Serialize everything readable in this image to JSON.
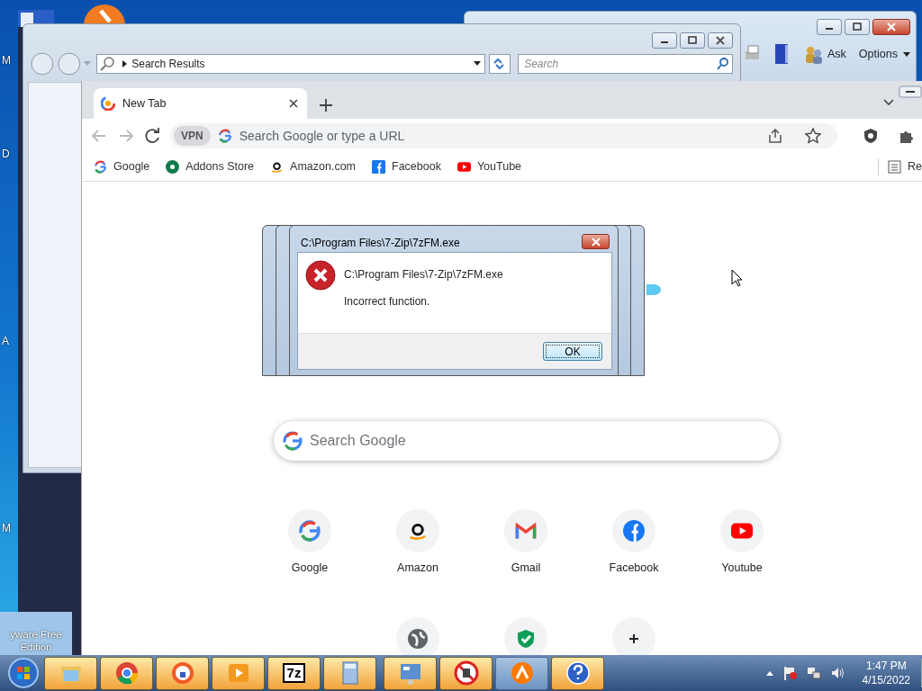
{
  "desktop": {
    "icon_labels": [
      "M",
      "D",
      "A",
      "M"
    ],
    "bottom_icon_label": [
      "yware Free",
      "Edition"
    ]
  },
  "help_window": {
    "toolbar": [
      {
        "kind": "print"
      },
      {
        "kind": "book"
      },
      {
        "kind": "ask",
        "label": "Ask"
      },
      {
        "kind": "options",
        "label": "Options"
      }
    ]
  },
  "explorer": {
    "address": "Search Results",
    "search_placeholder": "Search"
  },
  "browser": {
    "tabs": [
      {
        "title": "New Tab",
        "selected": true
      }
    ],
    "vpn_label": "VPN",
    "omnibox_placeholder": "Search Google or type a URL",
    "bookmarks": [
      {
        "label": "Google",
        "kind": "google"
      },
      {
        "label": "Addons Store",
        "kind": "addons"
      },
      {
        "label": "Amazon.com",
        "kind": "amazon"
      },
      {
        "label": "Facebook",
        "kind": "facebook"
      },
      {
        "label": "YouTube",
        "kind": "youtube"
      }
    ],
    "reading_list": "Re",
    "search_placeholder": "Search Google",
    "shortcuts": [
      {
        "label": "Google",
        "kind": "google"
      },
      {
        "label": "Amazon",
        "kind": "amazon"
      },
      {
        "label": "Gmail",
        "kind": "gmail"
      },
      {
        "label": "Facebook",
        "kind": "facebook"
      },
      {
        "label": "Youtube",
        "kind": "youtube"
      },
      {
        "kind": "globe"
      },
      {
        "kind": "shield"
      },
      {
        "kind": "add"
      }
    ]
  },
  "dialog": {
    "title": "C:\\Program Files\\7-Zip\\7zFM.exe",
    "heading": "C:\\Program Files\\7-Zip\\7zFM.exe",
    "message": "Incorrect function.",
    "button": "OK"
  },
  "taskbar": {
    "buttons": [
      {
        "kind": "folder",
        "flashing": true
      },
      {
        "kind": "chrome",
        "flashing": true
      },
      {
        "kind": "browser",
        "flashing": true
      },
      {
        "kind": "media",
        "flashing": true
      },
      {
        "kind": "zip",
        "label": "7z",
        "flashing": true
      },
      {
        "kind": "calculator",
        "flashing": true
      },
      {
        "kind": "panel",
        "flashing": true
      },
      {
        "kind": "blocked",
        "flashing": true
      },
      {
        "kind": "avast",
        "flashing": false
      },
      {
        "kind": "help",
        "flashing": true
      }
    ],
    "clock": {
      "time": "1:47 PM",
      "date": "4/15/2022"
    }
  }
}
